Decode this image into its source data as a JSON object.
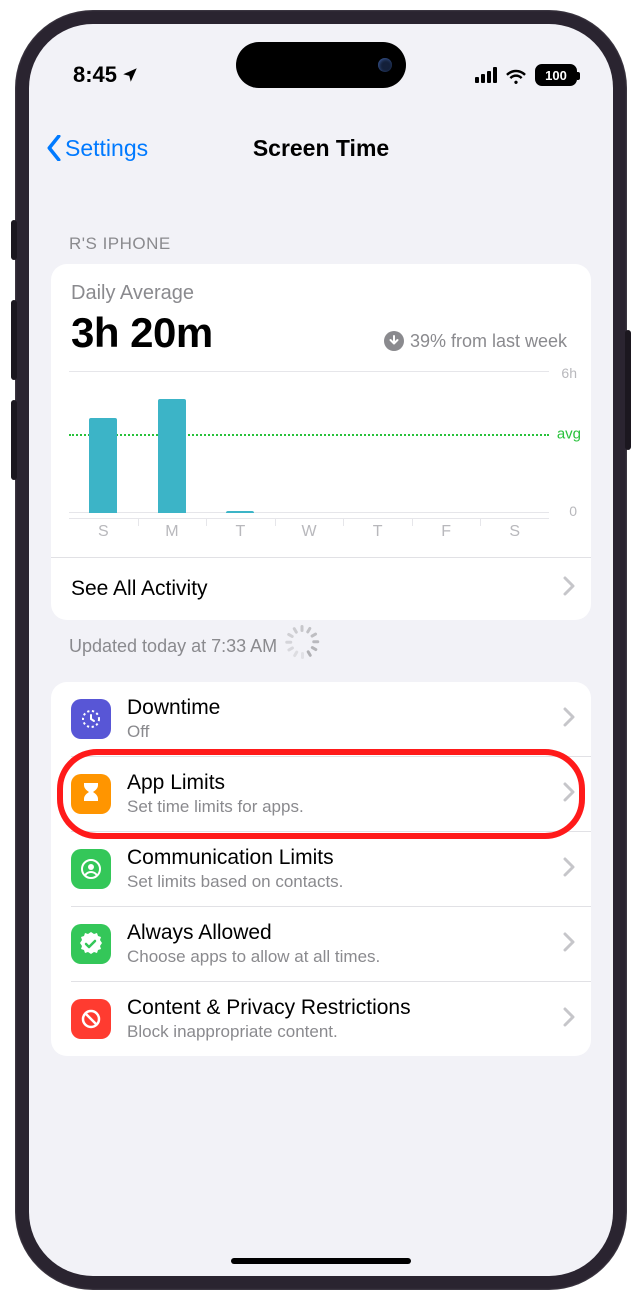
{
  "status": {
    "time": "8:45",
    "battery": "100"
  },
  "nav": {
    "back": "Settings",
    "title": "Screen Time"
  },
  "section": {
    "header": "R'S IPHONE"
  },
  "average": {
    "label": "Daily Average",
    "value": "3h 20m",
    "delta": "39% from last week"
  },
  "chart_data": {
    "type": "bar",
    "categories": [
      "S",
      "M",
      "T",
      "W",
      "T",
      "F",
      "S"
    ],
    "values": [
      4.0,
      4.8,
      0.1,
      0,
      0,
      0,
      0
    ],
    "avg": 3.33,
    "ylim": [
      0,
      6
    ],
    "ylabel_top": "6h",
    "ylabel_bot": "0",
    "avg_label": "avg"
  },
  "see_all": "See All Activity",
  "updated": "Updated today at 7:33 AM",
  "options": {
    "downtime": {
      "title": "Downtime",
      "sub": "Off"
    },
    "applimits": {
      "title": "App Limits",
      "sub": "Set time limits for apps."
    },
    "comm": {
      "title": "Communication Limits",
      "sub": "Set limits based on contacts."
    },
    "always": {
      "title": "Always Allowed",
      "sub": "Choose apps to allow at all times."
    },
    "content": {
      "title": "Content & Privacy Restrictions",
      "sub": "Block inappropriate content."
    }
  }
}
